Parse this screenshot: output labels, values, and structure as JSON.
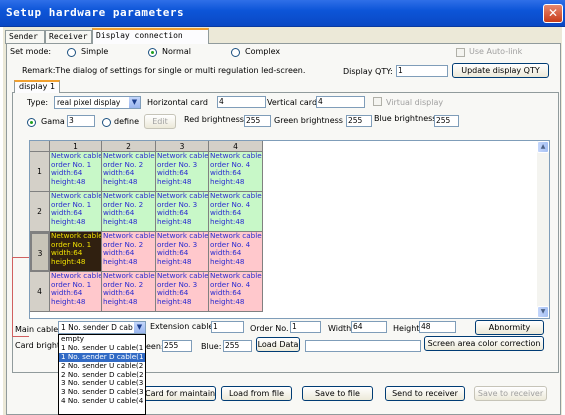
{
  "window": {
    "title": "Setup hardware parameters",
    "close": "✕"
  },
  "tabs": [
    "Sender",
    "Receiver",
    "Display connection"
  ],
  "set_mode": {
    "label": "Set mode:",
    "options": [
      "Simple",
      "Normal",
      "Complex"
    ],
    "selected": "Normal",
    "auto_link": "Use Auto-link"
  },
  "remark": "Remark:The dialog of settings for single or multi  regulation led-screen.",
  "display_qty": {
    "label": "Display QTY:",
    "value": "1",
    "button": "Update display QTY"
  },
  "display_tab": "display 1",
  "type": {
    "label": "Type:",
    "value": "real pixel display",
    "horizontal_label": "Horizontal card",
    "horizontal_value": "4",
    "vertical_label": "Vertical card",
    "vertical_value": "4",
    "virtual": "Virtual display"
  },
  "gamma": {
    "gama_label": "Gama",
    "gama_value": "3",
    "define_label": "define",
    "edit_button": "Edit",
    "red_label": "Red brightness",
    "red_value": "255",
    "green_label": "Green brightness",
    "green_value": "255",
    "blue_label": "Blue brightness",
    "blue_value": "255"
  },
  "grid": {
    "columns": [
      "1",
      "2",
      "3",
      "4"
    ],
    "rows": [
      {
        "label": "1",
        "cells": [
          [
            "Network cable",
            "order No. 1",
            "width:64",
            "height:48"
          ],
          [
            "Network cable",
            "order No. 2",
            "width:64",
            "height:48"
          ],
          [
            "Network cable",
            "order No. 3",
            "width:64",
            "height:48"
          ],
          [
            "Network cable",
            "order No. 4",
            "width:64",
            "height:48"
          ]
        ]
      },
      {
        "label": "2",
        "cells": [
          [
            "Network cable",
            "order No. 1",
            "width:64",
            "height:48"
          ],
          [
            "Network cable",
            "order No. 2",
            "width:64",
            "height:48"
          ],
          [
            "Network cable",
            "order No. 3",
            "width:64",
            "height:48"
          ],
          [
            "Network cable",
            "order No. 4",
            "width:64",
            "height:48"
          ]
        ]
      },
      {
        "label": "3",
        "cells": [
          [
            "Network cable",
            "order No. 1",
            "width:64",
            "height:48"
          ],
          [
            "Network cable",
            "order No. 2",
            "width:64",
            "height:48"
          ],
          [
            "Network cable",
            "order No. 3",
            "width:64",
            "height:48"
          ],
          [
            "Network cable",
            "order No. 4",
            "width:64",
            "height:48"
          ]
        ]
      },
      {
        "label": "4",
        "cells": [
          [
            "Network cable",
            "order No. 1",
            "width:64",
            "height:48"
          ],
          [
            "Network cable",
            "order No. 2",
            "width:64",
            "height:48"
          ],
          [
            "Network cable",
            "order No. 3",
            "width:64",
            "height:48"
          ],
          [
            "Network cable",
            "order No. 4",
            "width:64",
            "height:48"
          ]
        ]
      }
    ],
    "colors": {
      "green": "#c8f8c8",
      "pink": "#ffc8cc",
      "selected": "#302010"
    }
  },
  "card_row": {
    "main_cable_label": "Main cable",
    "main_cable_value": "1 No. sender D cab",
    "extension_label": "Extension cable",
    "extension_value": "1",
    "order_label": "Order No.",
    "order_value": "1",
    "width_label": "Width",
    "width_value": "64",
    "height_label": "Height",
    "height_value": "48",
    "abnormity": "Abnormity"
  },
  "bright_row": {
    "card_bright_label": "Card bright",
    "green_label": "een:",
    "green_value": "255",
    "blue_label": "Blue:",
    "blue_value": "255",
    "load_data": "Load Data",
    "screen_area": "Screen area color correction"
  },
  "dropdown": {
    "options": [
      "empty",
      "1 No. sender U cable(1",
      "1 No. sender D cable(1",
      "2 No. sender U cable(2",
      "2 No. sender D cable(2",
      "3 No. sender U cable(3",
      "3 No. sender D cable(3",
      "4 No. sender U cable(4"
    ],
    "selected": 2
  },
  "bottom_buttons": {
    "card_maintain": "Card for maintain",
    "load_file": "Load from file",
    "save_file": "Save to file",
    "send_receiver": "Send to receiver",
    "save_receiver": "Save to receiver"
  }
}
